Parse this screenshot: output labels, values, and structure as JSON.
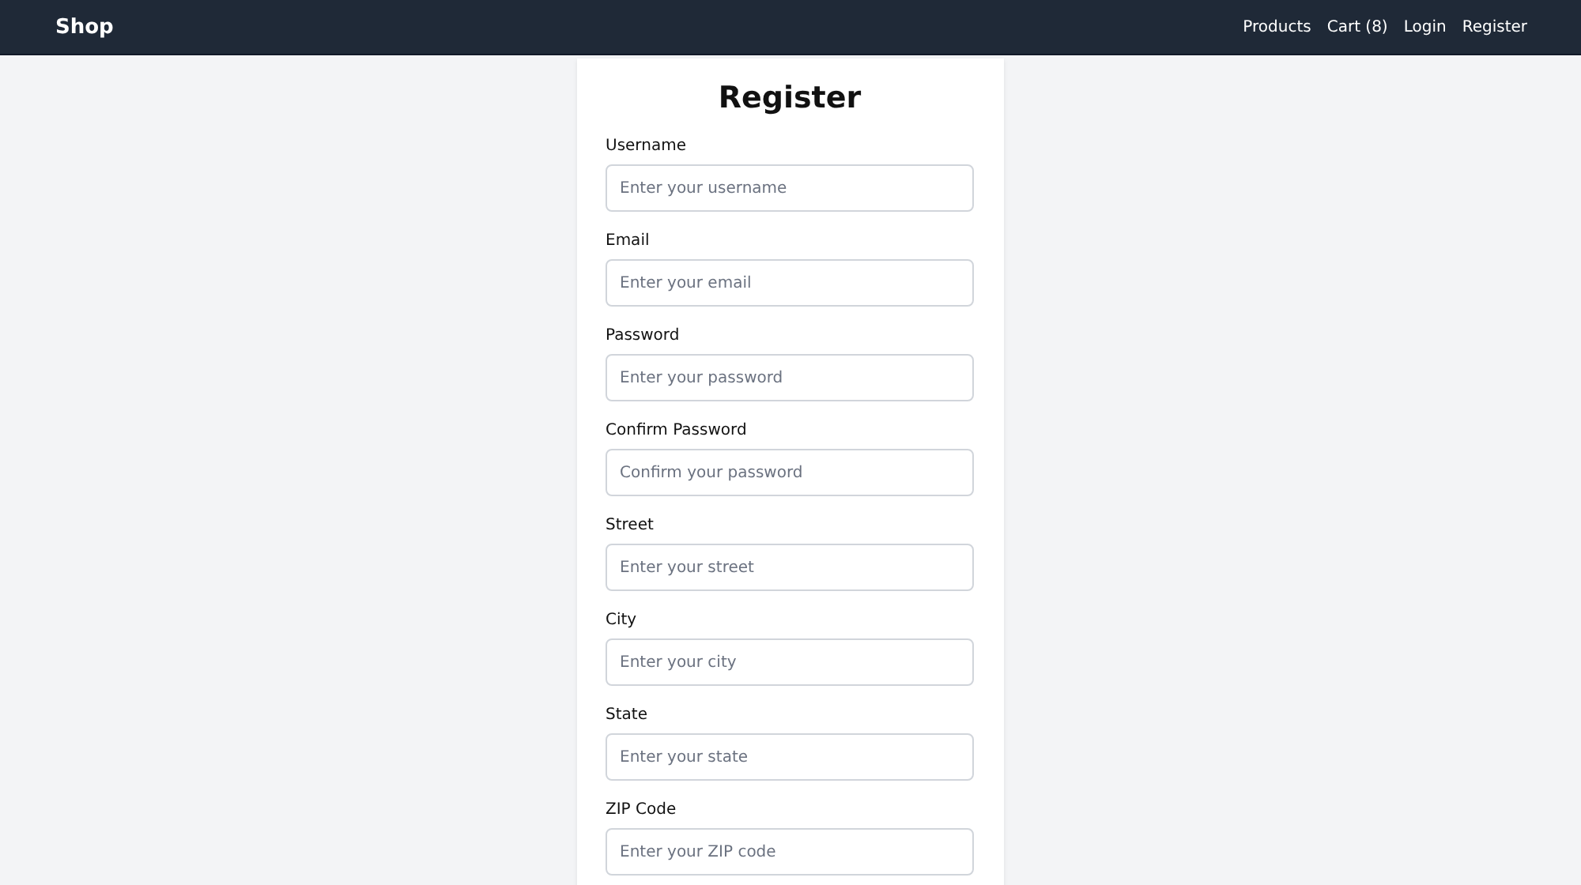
{
  "navbar": {
    "brand": "Shop",
    "links": [
      "Products",
      "Cart (8)",
      "Login",
      "Register"
    ]
  },
  "form": {
    "title": "Register",
    "fields": [
      {
        "label": "Username",
        "placeholder": "Enter your username"
      },
      {
        "label": "Email",
        "placeholder": "Enter your email"
      },
      {
        "label": "Password",
        "placeholder": "Enter your password"
      },
      {
        "label": "Confirm Password",
        "placeholder": "Confirm your password"
      },
      {
        "label": "Street",
        "placeholder": "Enter your street"
      },
      {
        "label": "City",
        "placeholder": "Enter your city"
      },
      {
        "label": "State",
        "placeholder": "Enter your state"
      },
      {
        "label": "ZIP Code",
        "placeholder": "Enter your ZIP code"
      }
    ]
  }
}
